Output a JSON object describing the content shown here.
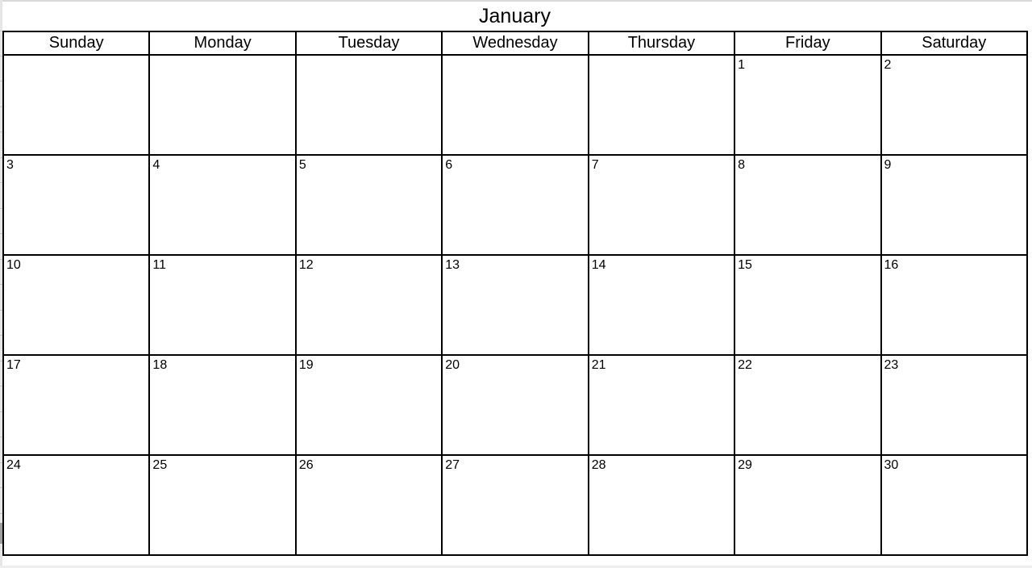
{
  "calendar": {
    "month": "January",
    "weekdays": [
      "Sunday",
      "Monday",
      "Tuesday",
      "Wednesday",
      "Thursday",
      "Friday",
      "Saturday"
    ],
    "weeks": [
      [
        "",
        "",
        "",
        "",
        "",
        "1",
        "2"
      ],
      [
        "3",
        "4",
        "5",
        "6",
        "7",
        "8",
        "9"
      ],
      [
        "10",
        "11",
        "12",
        "13",
        "14",
        "15",
        "16"
      ],
      [
        "17",
        "18",
        "19",
        "20",
        "21",
        "22",
        "23"
      ],
      [
        "24",
        "25",
        "26",
        "27",
        "28",
        "29",
        "30"
      ]
    ]
  }
}
